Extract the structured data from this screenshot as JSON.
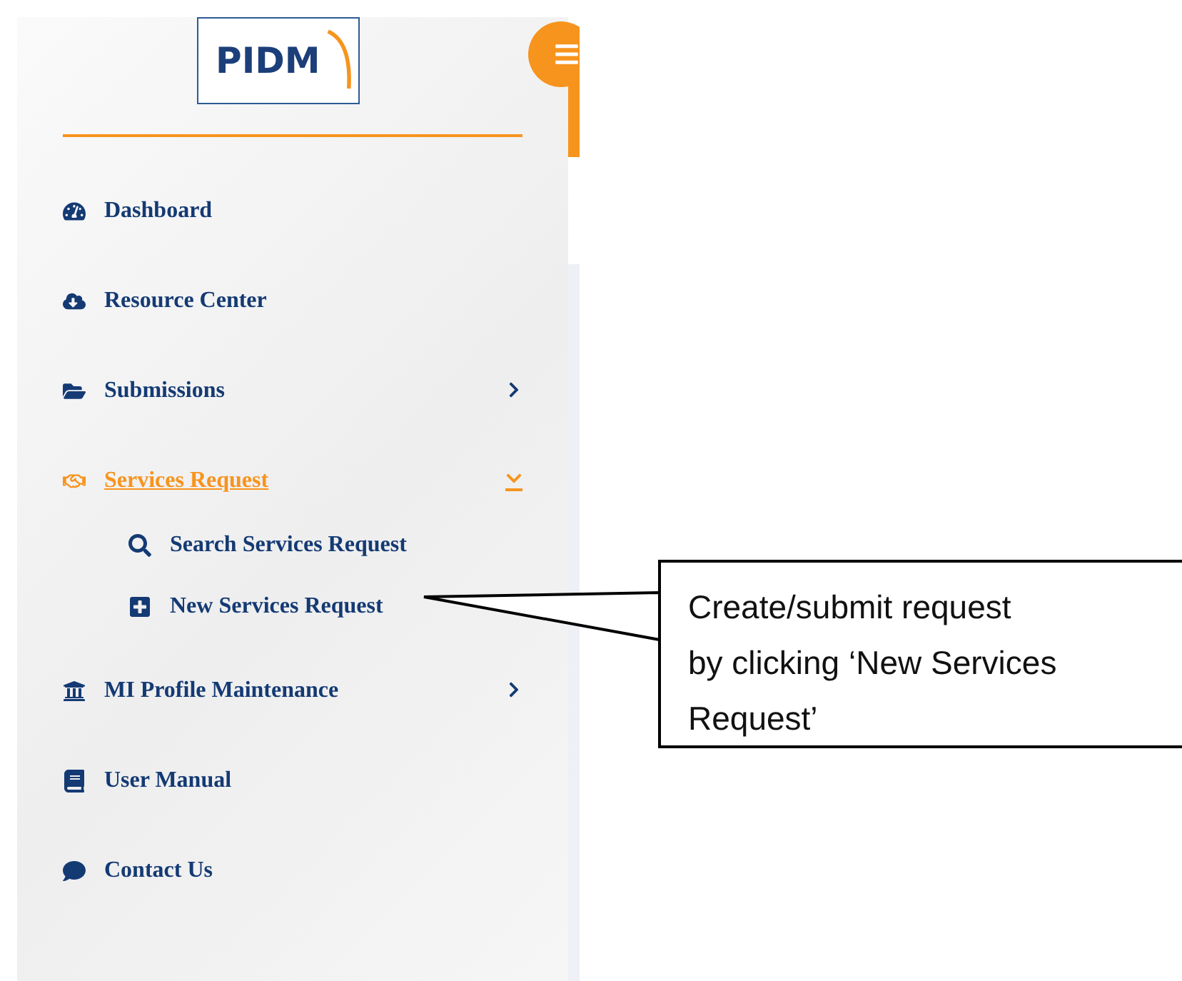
{
  "logo": {
    "text": "PIDM"
  },
  "nav": [
    {
      "label": "Dashboard",
      "selected": false
    },
    {
      "label": "Resource Center",
      "selected": false
    },
    {
      "label": "Submissions",
      "selected": false,
      "expanded": false
    },
    {
      "label": "Services Request",
      "selected": true,
      "expanded": true,
      "children": [
        {
          "label": "Search Services Request"
        },
        {
          "label": "New Services Request"
        }
      ]
    },
    {
      "label": "MI Profile Maintenance",
      "selected": false,
      "expanded": false
    },
    {
      "label": "User Manual",
      "selected": false
    },
    {
      "label": "Contact Us",
      "selected": false
    }
  ],
  "callout": {
    "lines": [
      "Create/submit request",
      "by clicking ‘New Services",
      "Request’"
    ]
  }
}
